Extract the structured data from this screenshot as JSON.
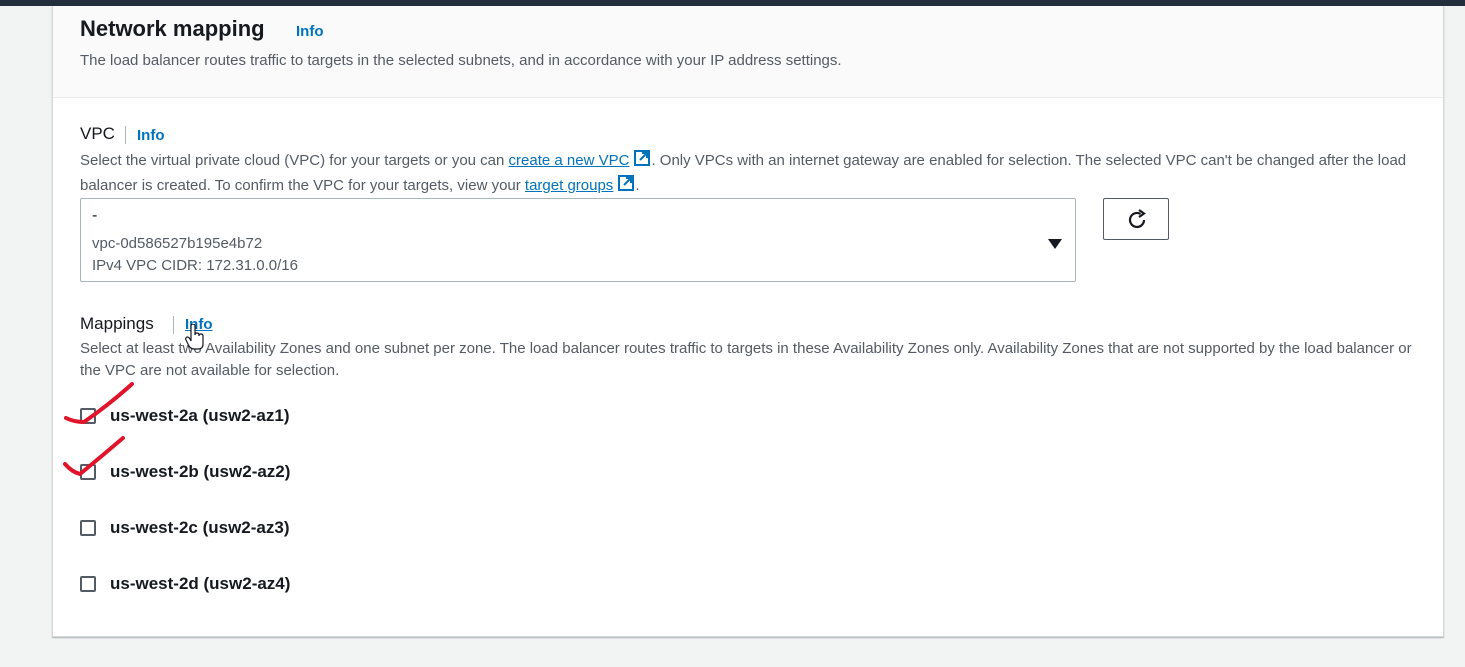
{
  "section": {
    "title": "Network mapping",
    "info": "Info",
    "description": "The load balancer routes traffic to targets in the selected subnets, and in accordance with your IP address settings."
  },
  "vpc": {
    "label": "VPC",
    "info": "Info",
    "desc_part1": "Select the virtual private cloud (VPC) for your targets or you can ",
    "create_link": "create a new VPC",
    "desc_part2": ". Only VPCs with an internet gateway are enabled for selection. The selected VPC can't be changed after the load balancer is created. To confirm the VPC for your targets, view your ",
    "target_groups_link": "target groups",
    "desc_part3": ".",
    "selected_name": "-",
    "selected_id": "vpc-0d586527b195e4b72",
    "selected_cidr": "IPv4 VPC CIDR: 172.31.0.0/16",
    "refresh_icon": "refresh-icon",
    "dropdown_icon": "caret-down-icon"
  },
  "mappings": {
    "label": "Mappings",
    "info": "Info",
    "description": "Select at least two Availability Zones and one subnet per zone. The load balancer routes traffic to targets in these Availability Zones only. Availability Zones that are not supported by the load balancer or the VPC are not available for selection.",
    "zones": [
      {
        "label": "us-west-2a (usw2-az1)",
        "checked": false
      },
      {
        "label": "us-west-2b (usw2-az2)",
        "checked": false
      },
      {
        "label": "us-west-2c (usw2-az3)",
        "checked": false
      },
      {
        "label": "us-west-2d (usw2-az4)",
        "checked": false
      }
    ]
  },
  "colors": {
    "link": "#0073bb",
    "annotation": "#e0142a",
    "topbar": "#232f3e"
  }
}
